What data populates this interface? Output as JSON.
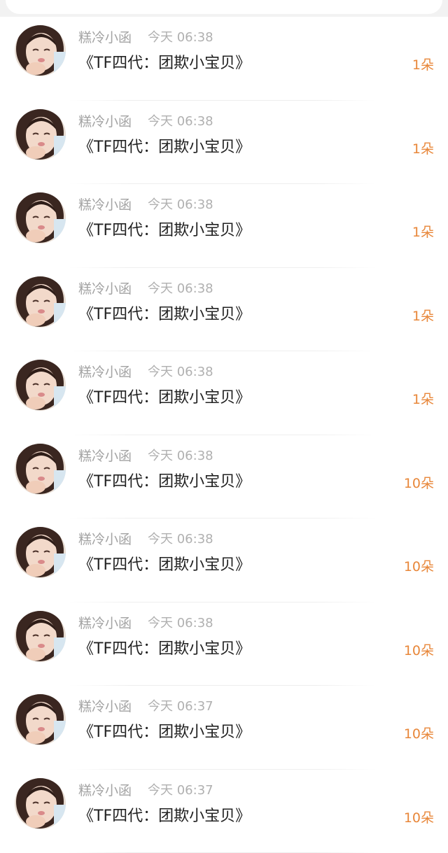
{
  "items": [
    {
      "user": "糕冷小函",
      "time": "今天 06:38",
      "title": "《TF四代：团欺小宝贝》",
      "count": "1朵"
    },
    {
      "user": "糕冷小函",
      "time": "今天 06:38",
      "title": "《TF四代：团欺小宝贝》",
      "count": "1朵"
    },
    {
      "user": "糕冷小函",
      "time": "今天 06:38",
      "title": "《TF四代：团欺小宝贝》",
      "count": "1朵"
    },
    {
      "user": "糕冷小函",
      "time": "今天 06:38",
      "title": "《TF四代：团欺小宝贝》",
      "count": "1朵"
    },
    {
      "user": "糕冷小函",
      "time": "今天 06:38",
      "title": "《TF四代：团欺小宝贝》",
      "count": "1朵"
    },
    {
      "user": "糕冷小函",
      "time": "今天 06:38",
      "title": "《TF四代：团欺小宝贝》",
      "count": "10朵"
    },
    {
      "user": "糕冷小函",
      "time": "今天 06:38",
      "title": "《TF四代：团欺小宝贝》",
      "count": "10朵"
    },
    {
      "user": "糕冷小函",
      "time": "今天 06:38",
      "title": "《TF四代：团欺小宝贝》",
      "count": "10朵"
    },
    {
      "user": "糕冷小函",
      "time": "今天 06:37",
      "title": "《TF四代：团欺小宝贝》",
      "count": "10朵"
    },
    {
      "user": "糕冷小函",
      "time": "今天 06:37",
      "title": "《TF四代：团欺小宝贝》",
      "count": "10朵"
    }
  ],
  "colors": {
    "accent": "#e8873a",
    "name_gray": "#a3a3a3",
    "title_text": "#222222",
    "search_icon": "#4a9ad9"
  },
  "icons": {
    "search": "search-icon",
    "avatar": "avatar-photo"
  }
}
